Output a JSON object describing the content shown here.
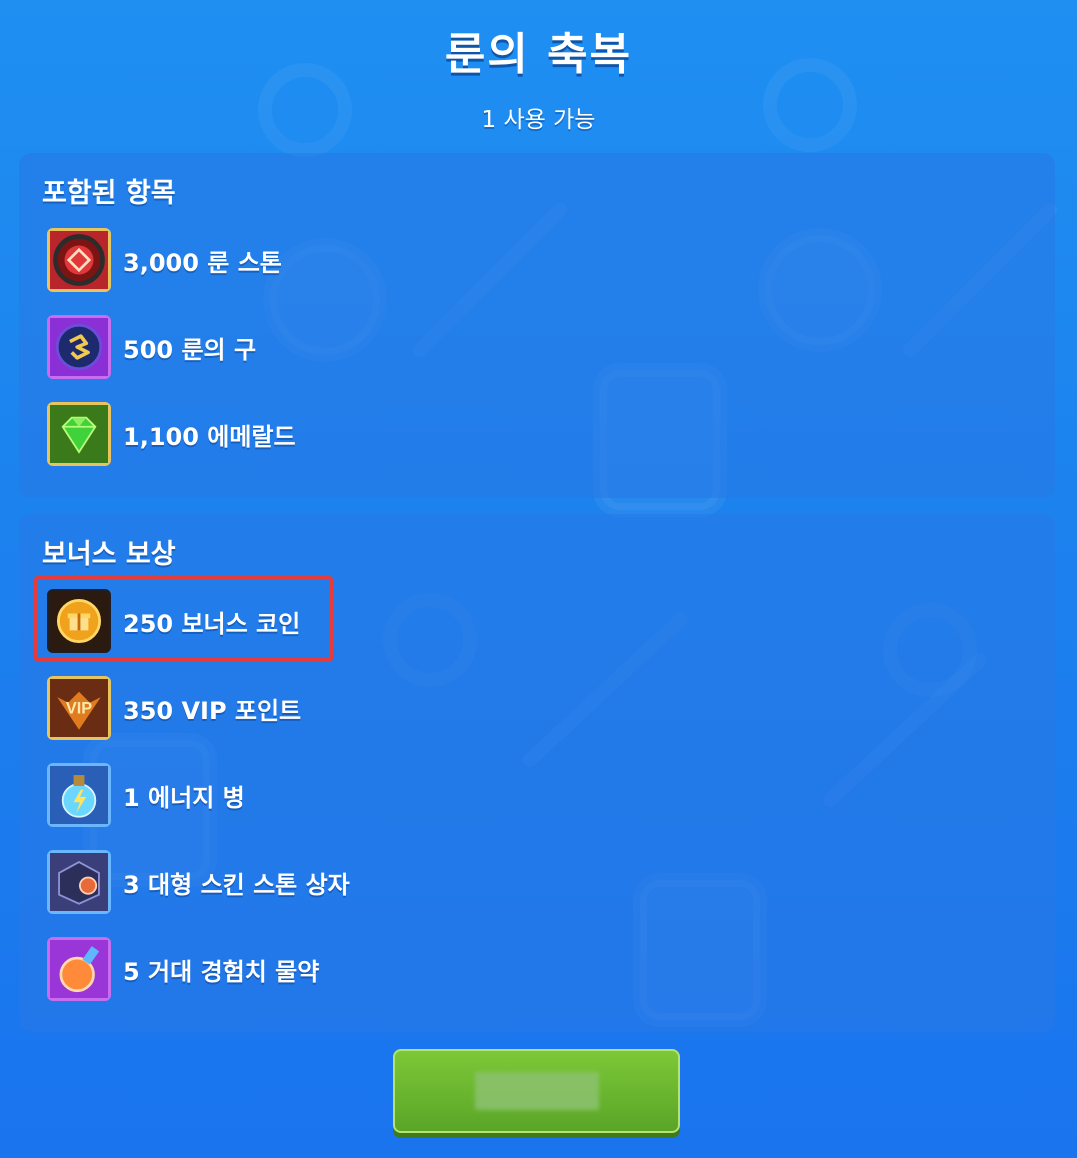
{
  "header": {
    "title": "룬의 축복",
    "subtitle": "1 사용 가능"
  },
  "included": {
    "title": "포함된 항목",
    "items": [
      {
        "label": "3,000 룬 스톤",
        "icon": "rune-stone-icon"
      },
      {
        "label": "500 룬의 구",
        "icon": "rune-orb-icon"
      },
      {
        "label": "1,100 에메랄드",
        "icon": "emerald-icon"
      }
    ]
  },
  "bonus": {
    "title": "보너스 보상",
    "items": [
      {
        "label": "250 보너스 코인",
        "icon": "bonus-coin-icon"
      },
      {
        "label": "350 VIP 포인트",
        "icon": "vip-points-icon"
      },
      {
        "label": "1 에너지 병",
        "icon": "energy-bottle-icon"
      },
      {
        "label": "3 대형 스킨 스톤 상자",
        "icon": "skin-stone-chest-icon"
      },
      {
        "label": "5 거대 경험치 물약",
        "icon": "exp-potion-icon"
      }
    ]
  },
  "button": {
    "label": ""
  },
  "colors": {
    "highlight": "#e53b3b",
    "button_green": "#6bb62f"
  }
}
